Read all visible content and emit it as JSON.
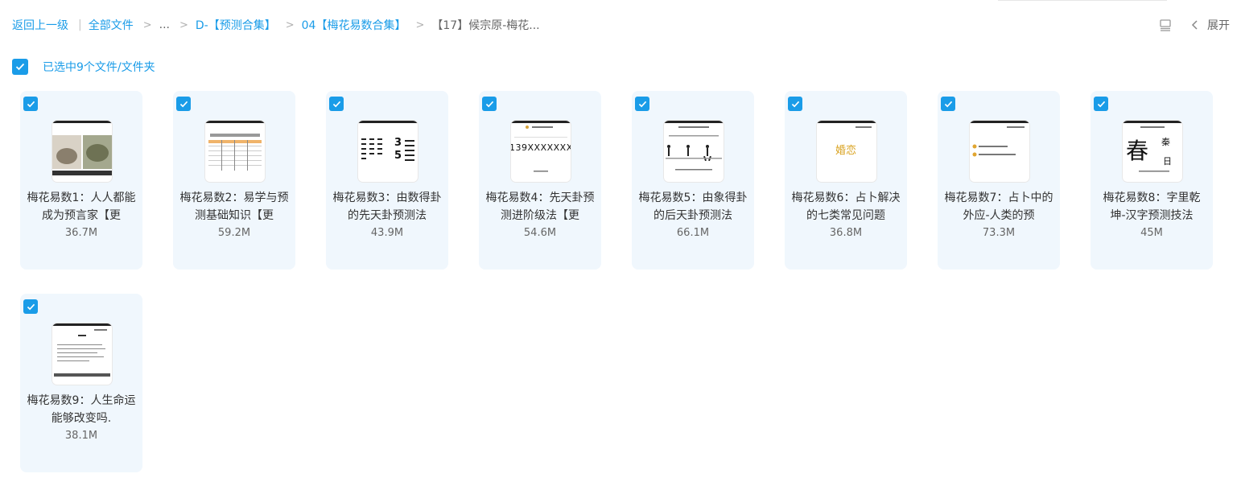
{
  "breadcrumb": {
    "back": "返回上一级",
    "all_files": "全部文件",
    "ellipsis": "...",
    "level1": "D-【预测合集】",
    "level2": "04【梅花易数合集】",
    "current": "【17】候宗原-梅花..."
  },
  "toolbar": {
    "expand_label": "展开"
  },
  "selection": {
    "text": "已选中9个文件/文件夹"
  },
  "colors": {
    "accent": "#1a9ce8",
    "card_bg": "#f0f7fd"
  },
  "files": [
    {
      "name": "梅花易数1：人人都能成为预言家【更",
      "size": "36.7M",
      "selected": true
    },
    {
      "name": "梅花易数2：易学与预测基础知识【更",
      "size": "59.2M",
      "selected": true
    },
    {
      "name": "梅花易数3：由数得卦的先天卦预测法",
      "size": "43.9M",
      "selected": true,
      "thumb_text": [
        "3",
        "5"
      ]
    },
    {
      "name": "梅花易数4：先天卦预测进阶级法【更",
      "size": "54.6M",
      "selected": true,
      "thumb_text": [
        "139XXXXXXXX"
      ]
    },
    {
      "name": "梅花易数5：由象得卦的后天卦预测法",
      "size": "66.1M",
      "selected": true
    },
    {
      "name": "梅花易数6：占卜解决的七类常见问题",
      "size": "36.8M",
      "selected": true,
      "thumb_text": [
        "婚恋"
      ]
    },
    {
      "name": "梅花易数7：占卜中的外应-人类的预",
      "size": "73.3M",
      "selected": true
    },
    {
      "name": "梅花易数8：字里乾坤-汉字预测技法",
      "size": "45M",
      "selected": true,
      "thumb_text": [
        "春",
        "秦",
        "日"
      ]
    },
    {
      "name": "梅花易数9：人生命运能够改变吗.",
      "size": "38.1M",
      "selected": true
    }
  ]
}
